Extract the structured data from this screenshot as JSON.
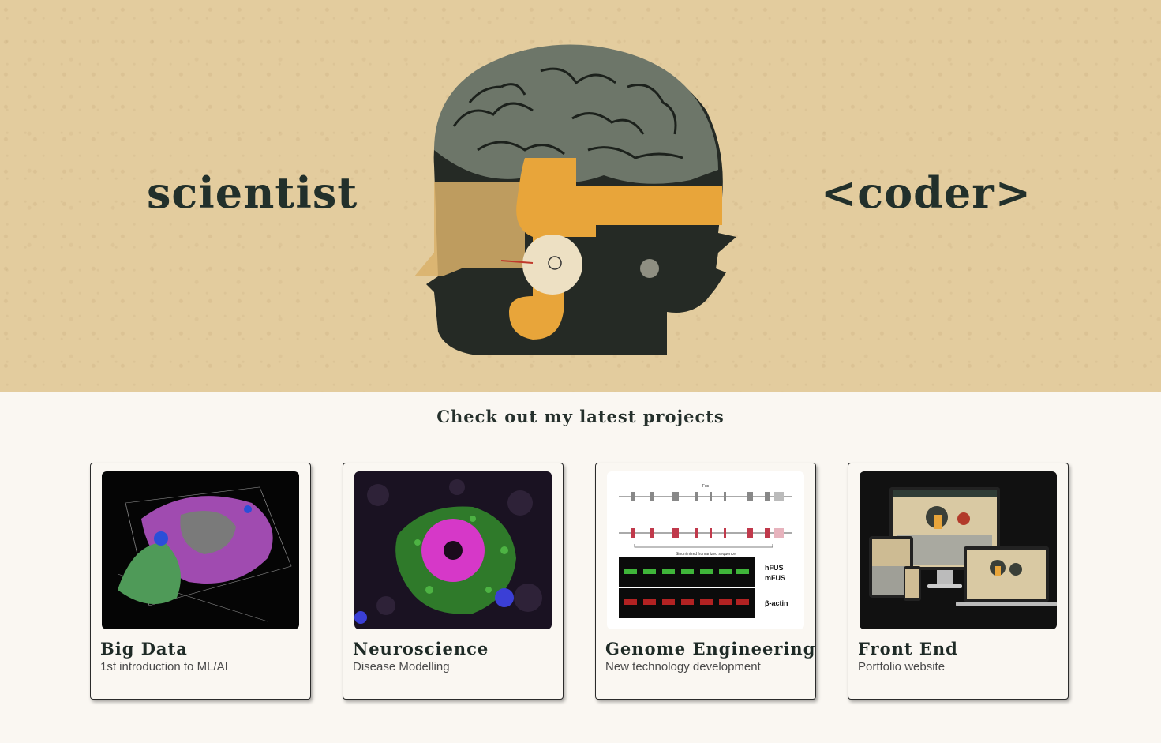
{
  "hero": {
    "left_word": "scientist",
    "right_word": "<coder>"
  },
  "projects": {
    "heading": "Check out my latest projects",
    "items": [
      {
        "title": "Big Data",
        "subtitle": "1st introduction to ML/AI"
      },
      {
        "title": "Neuroscience",
        "subtitle": "Disease Modelling"
      },
      {
        "title": "Genome Engineering",
        "subtitle": "New technology development",
        "figure": {
          "top_label": "Fus",
          "bracket_label": "Sinonimized humanized sequence",
          "band_labels": [
            "hFUS",
            "mFUS",
            "β-actin"
          ]
        }
      },
      {
        "title": "Front End",
        "subtitle": "Portfolio website"
      }
    ]
  },
  "colors": {
    "hero_bg": "#e3cc9e",
    "page_bg": "#faf7f2",
    "text_dark": "#1e2a26",
    "accent_orange": "#e8a53a"
  }
}
